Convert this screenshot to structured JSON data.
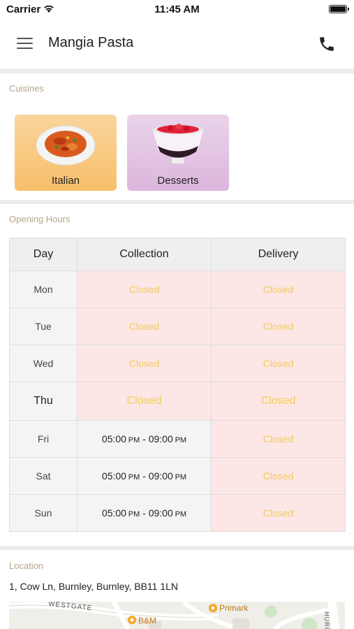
{
  "status_bar": {
    "carrier": "Carrier",
    "time": "11:45 AM"
  },
  "header": {
    "title": "Mangia Pasta",
    "menu_icon": "hamburger-menu-icon",
    "call_icon": "phone-icon"
  },
  "cuisines": {
    "title": "Cuisines",
    "items": [
      {
        "label": "Italian",
        "icon": "pasta-plate-image",
        "color": "#f9c77f"
      },
      {
        "label": "Desserts",
        "icon": "dessert-bowl-image",
        "color": "#e5c8e6"
      }
    ]
  },
  "opening_hours": {
    "title": "Opening Hours",
    "columns": [
      "Day",
      "Collection",
      "Delivery"
    ],
    "rows": [
      {
        "day": "Mon",
        "collection": "Closed",
        "delivery": "Closed"
      },
      {
        "day": "Tue",
        "collection": "Closed",
        "delivery": "Closed"
      },
      {
        "day": "Wed",
        "collection": "Closed",
        "delivery": "Closed"
      },
      {
        "day": "Thu",
        "collection": "Closed",
        "delivery": "Closed"
      },
      {
        "day": "Fri",
        "collection": {
          "start": "05:00",
          "start_ampm": "PM",
          "sep": " - ",
          "end": "09:00",
          "end_ampm": "PM"
        },
        "delivery": "Closed"
      },
      {
        "day": "Sat",
        "collection": {
          "start": "05:00",
          "start_ampm": "PM",
          "sep": " - ",
          "end": "09:00",
          "end_ampm": "PM"
        },
        "delivery": "Closed"
      },
      {
        "day": "Sun",
        "collection": {
          "start": "05:00",
          "start_ampm": "PM",
          "sep": " - ",
          "end": "09:00",
          "end_ampm": "PM"
        },
        "delivery": "Closed"
      }
    ],
    "colors": {
      "closed_bg": "#fde6e6",
      "closed_text": "#f0cc58"
    }
  },
  "location": {
    "title": "Location",
    "address": "1, Cow Ln, Burnley, Burnley, BB11 1LN",
    "map_labels": {
      "street": "WESTGATE",
      "poi1": "B&M",
      "poi2": "Primark",
      "edge": "HURC"
    }
  }
}
